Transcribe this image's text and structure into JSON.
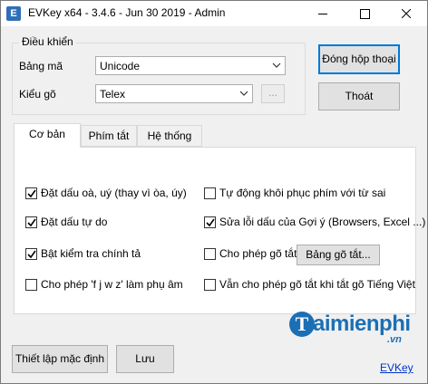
{
  "window": {
    "title": "EVKey x64 - 3.4.6 - Jun 30 2019 - Admin",
    "icon_letter": "E"
  },
  "control_group": {
    "legend": "Điều khiển",
    "charset_label": "Bảng mã",
    "charset_value": "Unicode",
    "method_label": "Kiểu gõ",
    "method_value": "Telex",
    "more_label": "..."
  },
  "buttons": {
    "close_dialog": "Đóng hộp thoại",
    "exit": "Thoát",
    "reset_defaults": "Thiết lập mặc định",
    "save": "Lưu",
    "shortcut_table": "Bảng gõ tắt..."
  },
  "tabs": [
    "Cơ bản",
    "Phím tắt",
    "Hệ thống"
  ],
  "options": {
    "tone_old_style": {
      "label": "Đặt dấu oà, uý (thay vì òa, úy)",
      "checked": true
    },
    "free_tone": {
      "label": "Đặt dấu tự do",
      "checked": true
    },
    "spell_check": {
      "label": "Bật kiểm tra chính tả",
      "checked": true
    },
    "fjwz_consonant": {
      "label": "Cho phép 'f j w z' làm phụ âm",
      "checked": false
    },
    "auto_restore": {
      "label": "Tự động khôi phục phím với từ sai",
      "checked": false
    },
    "fix_suggest": {
      "label": "Sửa lỗi dấu của Gợi ý (Browsers, Excel ...)",
      "checked": true
    },
    "allow_shortcut": {
      "label": "Cho phép gõ tắt",
      "checked": false
    },
    "shortcut_when_off": {
      "label": "Vẫn cho phép gõ tắt khi tắt gõ Tiếng Việt",
      "checked": false
    }
  },
  "watermark": {
    "letter": "T",
    "text": "aimienphi",
    "sub": ".vn"
  },
  "footer_link": "EVKey"
}
